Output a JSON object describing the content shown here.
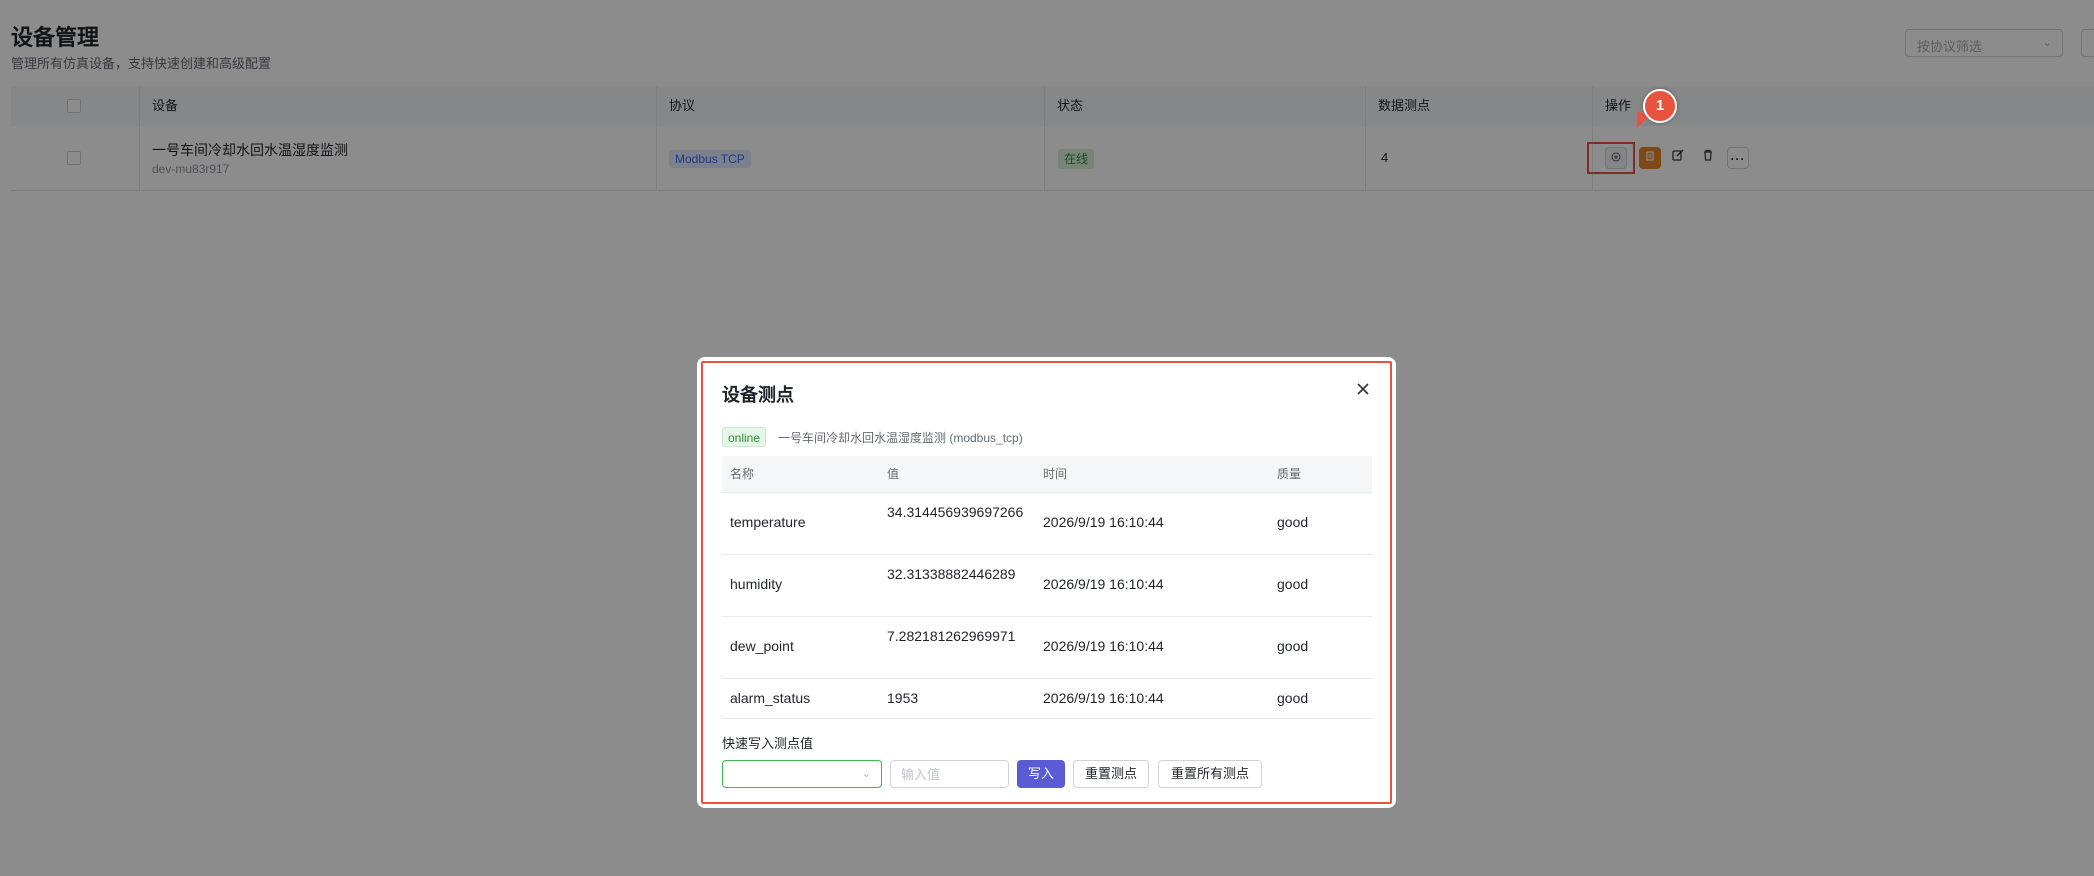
{
  "page": {
    "title": "设备管理",
    "subtitle": "管理所有仿真设备，支持快速创建和高级配置",
    "filter_placeholder": "按协议筛选"
  },
  "table": {
    "columns": [
      "设备",
      "协议",
      "状态",
      "数据测点",
      "操作"
    ],
    "rows": [
      {
        "name": "一号车间冷却水回水温湿度监测",
        "id": "dev-mu83r917",
        "protocol": "Modbus TCP",
        "status": "在线",
        "points": "4"
      }
    ]
  },
  "actions": {
    "view": "view-icon",
    "doc": "document-icon",
    "edit": "edit-icon",
    "delete": "trash-icon",
    "more": "···"
  },
  "annotation": {
    "callout_number": "1",
    "color": "#e8533e"
  },
  "modal": {
    "title": "设备测点",
    "status_tag": "online",
    "device_info": "一号车间冷却水回水温湿度监测 (modbus_tcp)",
    "columns": [
      "名称",
      "值",
      "时间",
      "质量"
    ],
    "points": [
      {
        "name": "temperature",
        "value": "34.314456939697266",
        "time": "2026/9/19 16:10:44",
        "quality": "good"
      },
      {
        "name": "humidity",
        "value": "32.31338882446289",
        "time": "2026/9/19 16:10:44",
        "quality": "good"
      },
      {
        "name": "dew_point",
        "value": "7.282181262969971",
        "time": "2026/9/19 16:10:44",
        "quality": "good"
      },
      {
        "name": "alarm_status",
        "value": "1953",
        "time": "2026/9/19 16:10:44",
        "quality": "good"
      }
    ],
    "quick_write_label": "快速写入测点值",
    "select_value": "",
    "input_placeholder": "输入值",
    "write_button": "写入",
    "reset_button": "重置测点",
    "reset_all_button": "重置所有测点"
  },
  "colors": {
    "primary": "#5b5bd6",
    "online_green": "#2e8b3e",
    "protocol_blue": "#3370ff",
    "doc_orange": "#e8832a"
  }
}
